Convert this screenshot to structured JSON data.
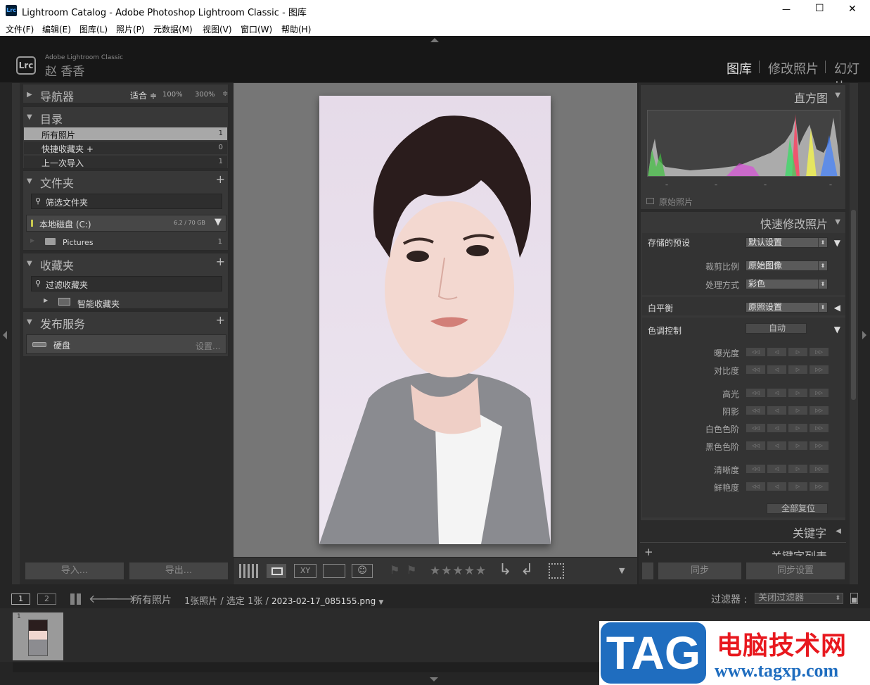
{
  "window": {
    "title": "Lightroom Catalog - Adobe Photoshop Lightroom Classic - 图库",
    "minimize": "—",
    "maximize": "☐",
    "close": "✕"
  },
  "menu": [
    "文件(F)",
    "编辑(E)",
    "图库(L)",
    "照片(P)",
    "元数据(M)",
    "视图(V)",
    "窗口(W)",
    "帮助(H)"
  ],
  "identity": {
    "logo": "Lrc",
    "product": "Adobe Lightroom Classic",
    "user": "赵 香香"
  },
  "modules": [
    "图库",
    "修改照片",
    "幻灯片"
  ],
  "left": {
    "navigator": {
      "title": "导航器",
      "zoom": [
        "适合 ≑",
        "100%",
        "300%",
        "≑"
      ]
    },
    "catalog": {
      "title": "目录",
      "items": [
        {
          "label": "所有照片",
          "count": "1"
        },
        {
          "label": "快捷收藏夹 +",
          "count": "0"
        },
        {
          "label": "上一次导入",
          "count": "1"
        }
      ]
    },
    "folders": {
      "title": "文件夹",
      "plus": "+",
      "filter_placeholder": "筛选文件夹",
      "volume": "本地磁盘 (C:)",
      "volume_size": "6.2 / 70 GB",
      "folder": "Pictures",
      "folder_count": "1"
    },
    "collections": {
      "title": "收藏夹",
      "plus": "+",
      "filter_placeholder": "过滤收藏夹",
      "smart": "智能收藏夹"
    },
    "publish": {
      "title": "发布服务",
      "plus": "+",
      "service": "硬盘",
      "setup": "设置..."
    },
    "import_label": "导入...",
    "export_label": "导出..."
  },
  "right": {
    "histogram": {
      "title": "直方图",
      "original": "原始照片",
      "marks": [
        "–",
        "–",
        "–",
        "–"
      ]
    },
    "quick_develop": {
      "title": "快速修改照片",
      "saved_preset": {
        "label": "存储的预设",
        "value": "默认设置"
      },
      "crop": {
        "label": "裁剪比例",
        "value": "原始图像"
      },
      "treatment": {
        "label": "处理方式",
        "value": "彩色"
      },
      "white_balance": {
        "label": "白平衡",
        "value": "原照设置"
      },
      "tone": {
        "label": "色调控制",
        "auto": "自动"
      },
      "sliders": [
        "曝光度",
        "对比度",
        "高光",
        "阴影",
        "白色色阶",
        "黑色色阶",
        "清晰度",
        "鲜艳度"
      ],
      "reset_all": "全部复位",
      "step": [
        "◁◁",
        "◁",
        "▷",
        "▷▷"
      ]
    },
    "keywording": {
      "title": "关键字"
    },
    "keyword_list": {
      "title": "关键字列表"
    },
    "sync": "同步",
    "sync_settings": "同步设置"
  },
  "toolbar": {
    "stars": "★★★★★"
  },
  "filmstrip": {
    "screens": [
      "1",
      "2"
    ],
    "source": "所有照片",
    "info_count": "1张照片 / 选定",
    "info_sel": "1张",
    "filename": "2023-02-17_085155.png",
    "filter_label": "过滤器 :",
    "filter_value": "关闭过滤器",
    "thumb_index": "1"
  },
  "watermark": {
    "tag": "TAG",
    "title": "电脑技术网",
    "url": "www.tagxp.com"
  },
  "colors": {
    "panel": "#383838",
    "accent_blue": "#1f6dbf",
    "watermark_red": "#e8181e"
  }
}
